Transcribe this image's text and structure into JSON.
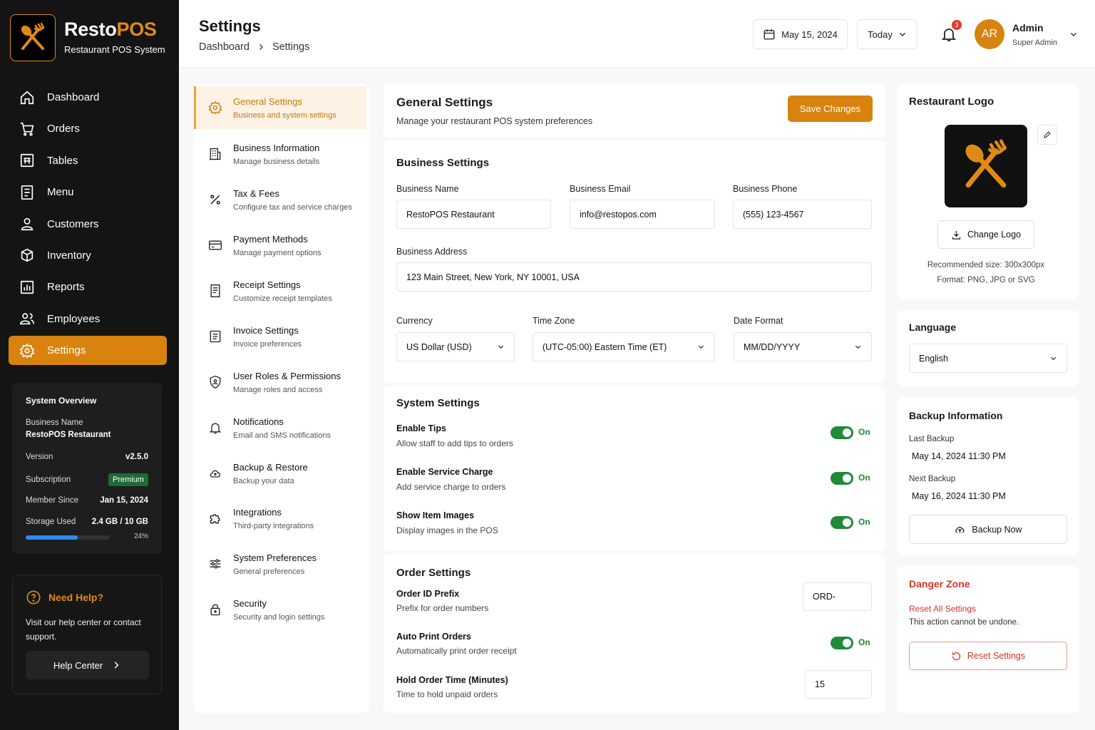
{
  "brand": {
    "name_a": "Resto",
    "name_b": "POS",
    "subtitle": "Restaurant POS System"
  },
  "nav": [
    {
      "label": "Dashboard",
      "icon": "home-icon"
    },
    {
      "label": "Orders",
      "icon": "cart-icon"
    },
    {
      "label": "Tables",
      "icon": "table-icon"
    },
    {
      "label": "Menu",
      "icon": "menu-book-icon"
    },
    {
      "label": "Customers",
      "icon": "user-icon"
    },
    {
      "label": "Inventory",
      "icon": "boxes-icon"
    },
    {
      "label": "Reports",
      "icon": "report-icon"
    },
    {
      "label": "Employees",
      "icon": "users-icon"
    },
    {
      "label": "Settings",
      "icon": "gear-icon",
      "active": true
    }
  ],
  "overview": {
    "title": "System Overview",
    "business_label": "Business Name",
    "business_value": "RestoPOS Restaurant",
    "version_label": "Version",
    "version_value": "v2.5.0",
    "subscription_label": "Subscription",
    "subscription_value": "Premium",
    "member_label": "Member Since",
    "member_value": "Jan 15, 2024",
    "storage_label": "Storage Used",
    "storage_value": "2.4 GB / 10 GB",
    "storage_pct_text": "24%",
    "storage_fraction": 0.24
  },
  "help": {
    "title": "Need Help?",
    "text": "Visit our help center or contact support.",
    "button": "Help Center"
  },
  "header": {
    "title": "Settings",
    "breadcrumb": [
      "Dashboard",
      "Settings"
    ],
    "date": "May 15, 2024",
    "range": "Today",
    "notif_count": "3",
    "avatar": "AR",
    "user_name": "Admin",
    "user_role": "Super Admin"
  },
  "settings_menu": [
    {
      "title": "General Settings",
      "sub": "Business and system settings",
      "icon": "gear-icon",
      "active": true
    },
    {
      "title": "Business Information",
      "sub": "Manage business details",
      "icon": "building-icon"
    },
    {
      "title": "Tax & Fees",
      "sub": "Configure tax and service charges",
      "icon": "percent-icon"
    },
    {
      "title": "Payment Methods",
      "sub": "Manage payment options",
      "icon": "credit-card-icon"
    },
    {
      "title": "Receipt Settings",
      "sub": "Customize receipt templates",
      "icon": "receipt-icon"
    },
    {
      "title": "Invoice Settings",
      "sub": "Invoice preferences",
      "icon": "invoice-icon"
    },
    {
      "title": "User Roles & Permissions",
      "sub": "Manage roles and access",
      "icon": "shield-icon"
    },
    {
      "title": "Notifications",
      "sub": "Email and SMS notifications",
      "icon": "bell-icon"
    },
    {
      "title": "Backup & Restore",
      "sub": "Backup your data",
      "icon": "cloud-icon"
    },
    {
      "title": "Integrations",
      "sub": "Third-party integrations",
      "icon": "puzzle-icon"
    },
    {
      "title": "System Preferences",
      "sub": "General preferences",
      "icon": "sliders-icon"
    },
    {
      "title": "Security",
      "sub": "Security and login settings",
      "icon": "lock-icon"
    }
  ],
  "general": {
    "title": "General Settings",
    "subtitle": "Manage your restaurant POS system preferences",
    "save": "Save Changes"
  },
  "business": {
    "section": "Business Settings",
    "name_label": "Business Name",
    "name_value": "RestoPOS Restaurant",
    "email_label": "Business Email",
    "email_value": "info@restopos.com",
    "phone_label": "Business Phone",
    "phone_value": "(555) 123-4567",
    "address_label": "Business Address",
    "address_value": "123 Main Street, New York, NY 10001, USA",
    "currency_label": "Currency",
    "currency_value": "US Dollar (USD)",
    "tz_label": "Time Zone",
    "tz_value": "(UTC-05:00) Eastern Time (ET)",
    "date_label": "Date Format",
    "date_value": "MM/DD/YYYY"
  },
  "system": {
    "section": "System Settings",
    "rows": [
      {
        "title": "Enable Tips",
        "sub": "Allow staff to add tips to orders",
        "state": "On"
      },
      {
        "title": "Enable Service Charge",
        "sub": "Add service charge to orders",
        "state": "On"
      },
      {
        "title": "Show Item Images",
        "sub": "Display images in the POS",
        "state": "On"
      }
    ]
  },
  "order": {
    "section": "Order Settings",
    "prefix_title": "Order ID Prefix",
    "prefix_sub": "Prefix for order numbers",
    "prefix_value": "ORD-",
    "print_title": "Auto Print Orders",
    "print_sub": "Automatically print order receipt",
    "print_state": "On",
    "hold_title": "Hold Order Time (Minutes)",
    "hold_sub": "Time to hold unpaid orders",
    "hold_value": "15"
  },
  "logo": {
    "title": "Restaurant Logo",
    "change": "Change Logo",
    "rec": "Recommended size: 300x300px",
    "format": "Format: PNG, JPG or SVG"
  },
  "language": {
    "title": "Language",
    "value": "English"
  },
  "backup": {
    "title": "Backup Information",
    "last_label": "Last Backup",
    "last_value": "May 14, 2024 11:30 PM",
    "next_label": "Next Backup",
    "next_value": "May 16, 2024 11:30 PM",
    "button": "Backup Now"
  },
  "danger": {
    "title": "Danger Zone",
    "reset_link": "Reset All Settings",
    "warning": "This action cannot be undone.",
    "button": "Reset Settings"
  },
  "colors": {
    "accent": "#d8830f",
    "sidebar": "#141414",
    "toggle_on": "#1e8a3a",
    "danger": "#d9332a"
  }
}
